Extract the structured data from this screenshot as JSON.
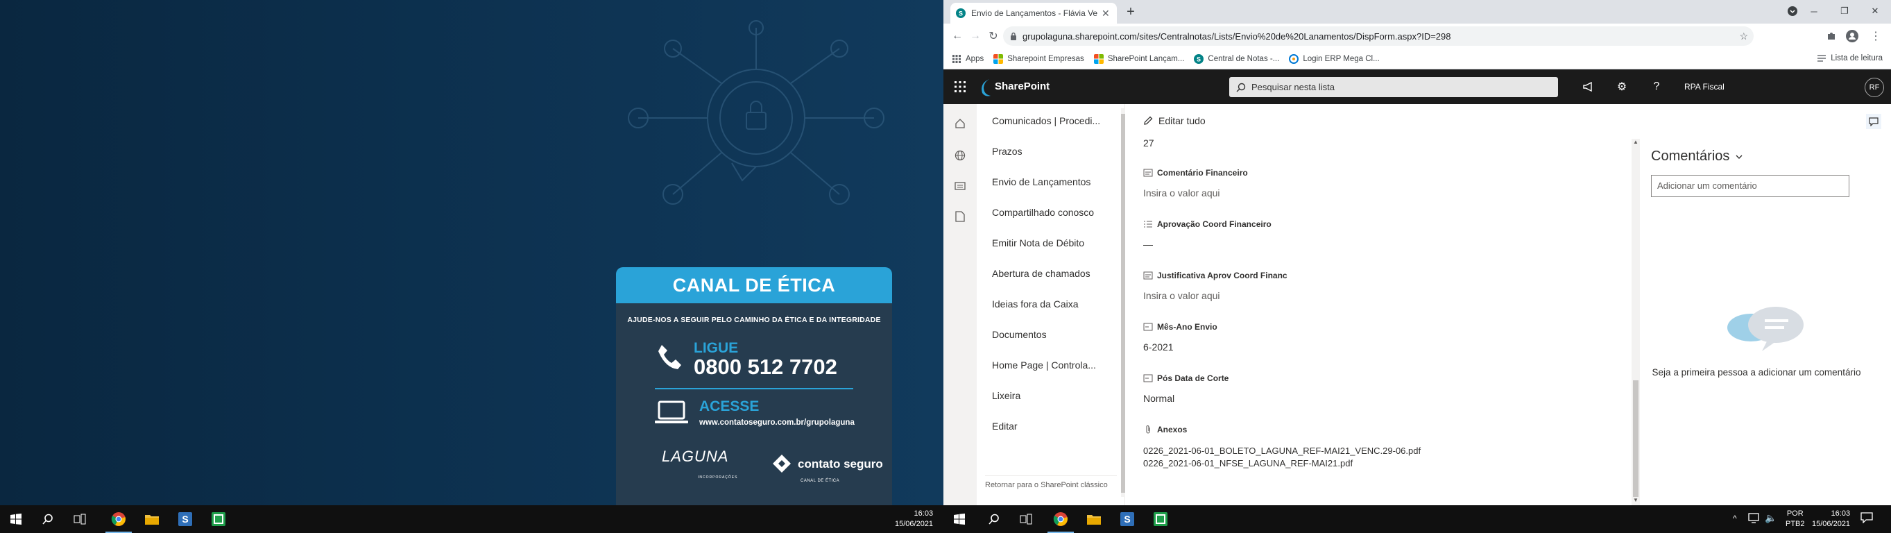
{
  "wallpaper": {
    "card_title": "CANAL DE ÉTICA",
    "card_subtitle": "AJUDE-NOS A SEGUIR PELO CAMINHO DA ÉTICA E DA INTEGRIDADE",
    "phone_label": "LIGUE",
    "phone_number": "0800 512 7702",
    "web_label": "ACESSE",
    "web_url": "www.contatoseguro.com.br/grupolaguna",
    "logo_left": "LAGUNA",
    "logo_left_sub": "INCORPORAÇÕES",
    "logo_right": "contato seguro",
    "logo_right_sub": "CANAL DE ÉTICA"
  },
  "left_taskbar": {
    "time": "16:03",
    "date": "15/06/2021"
  },
  "browser": {
    "tab_title": "Envio de Lançamentos - Flávia Ve",
    "url": "grupolaguna.sharepoint.com/sites/Centralnotas/Lists/Envio%20de%20Lanamentos/DispForm.aspx?ID=298",
    "bookmarks": [
      {
        "label": "Apps",
        "icon": "apps-grid-icon",
        "color": "#5f6368"
      },
      {
        "label": "Sharepoint Empresas",
        "icon": "microsoft-icon",
        "color": "#f25022"
      },
      {
        "label": "SharePoint Lançam...",
        "icon": "microsoft-icon",
        "color": "#f25022"
      },
      {
        "label": "Central de Notas -...",
        "icon": "sharepoint-icon",
        "color": "#038387"
      },
      {
        "label": "Login ERP Mega Cl...",
        "icon": "mega-icon",
        "color": "#0078d4"
      }
    ],
    "reading_list": "Lista de leitura"
  },
  "sharepoint": {
    "brand": "SharePoint",
    "search_placeholder": "Pesquisar nesta lista",
    "user_name": "RPA Fiscal",
    "user_initials": "RF",
    "nav_items": [
      "Comunicados | Procedi...",
      "Prazos",
      "Envio de Lançamentos",
      "Compartilhado conosco",
      "Emitir Nota de Débito",
      "Abertura de chamados",
      "Ideias fora da Caixa",
      "Documentos",
      "Home Page | Controla...",
      "Lixeira",
      "Editar"
    ],
    "nav_classic": "Retornar para o SharePoint clássico",
    "edit_all": "Editar tudo",
    "top_value": "27",
    "fields": [
      {
        "label": "Comentário Financeiro",
        "value": "Insira o valor aqui",
        "placeholder": true
      },
      {
        "label": "Aprovação Coord Financeiro",
        "value": "—",
        "placeholder": false
      },
      {
        "label": "Justificativa Aprov Coord Financ",
        "value": "Insira o valor aqui",
        "placeholder": true
      },
      {
        "label": "Mês-Ano Envio",
        "value": "6-2021",
        "placeholder": false
      },
      {
        "label": "Pós Data de Corte",
        "value": "Normal",
        "placeholder": false
      }
    ],
    "attachments_label": "Anexos",
    "attachments": [
      "0226_2021-06-01_BOLETO_LAGUNA_REF-MAI21_VENC.29-06.pdf",
      "0226_2021-06-01_NFSE_LAGUNA_REF-MAI21.pdf"
    ],
    "comments_title": "Comentários",
    "comment_placeholder": "Adicionar um comentário",
    "comments_empty": "Seja a primeira pessoa a adicionar um comentário"
  },
  "right_taskbar": {
    "lang1": "POR",
    "lang2": "PTB2",
    "time": "16:03",
    "date": "15/06/2021"
  }
}
